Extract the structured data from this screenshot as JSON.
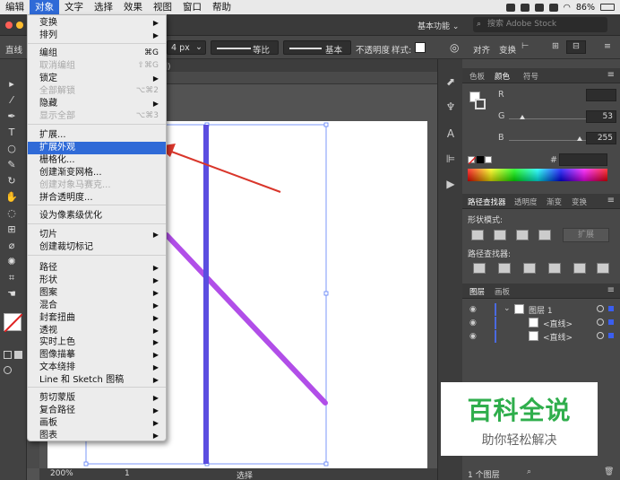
{
  "menubar": {
    "items": [
      "编辑",
      "对象",
      "文字",
      "选择",
      "效果",
      "视图",
      "窗口",
      "帮助"
    ],
    "active_index": 1,
    "battery": "86%"
  },
  "titlebar": {
    "workspace": "基本功能",
    "stock_search_placeholder": "搜索 Adobe Stock"
  },
  "controlbar": {
    "tool_label": "直线",
    "stroke_size": "4 px",
    "profile_label": "等比",
    "brush_label": "基本",
    "opacity_label": "不透明度",
    "style_label": "样式:",
    "align_label": "对齐",
    "transform_label": "变换"
  },
  "document": {
    "tab_suffix": "图)",
    "zoom": "200%",
    "page": "1",
    "status_label": "选择"
  },
  "object_menu": {
    "items": [
      {
        "label": "变换",
        "submenu": true
      },
      {
        "label": "排列",
        "submenu": true
      },
      {
        "label": "编组",
        "shortcut": "⌘G"
      },
      {
        "label": "取消编组",
        "shortcut": "⇧⌘G",
        "disabled": true
      },
      {
        "label": "锁定",
        "submenu": true
      },
      {
        "label": "全部解锁",
        "shortcut": "⌥⌘2",
        "disabled": true
      },
      {
        "label": "隐藏",
        "submenu": true
      },
      {
        "label": "显示全部",
        "shortcut": "⌥⌘3",
        "disabled": true
      },
      {
        "label": "扩展..."
      },
      {
        "label": "扩展外观",
        "highlighted": true
      },
      {
        "label": "栅格化..."
      },
      {
        "label": "创建渐变网格..."
      },
      {
        "label": "创建对象马赛克...",
        "disabled": true
      },
      {
        "label": "拼合透明度..."
      },
      {
        "label": "设为像素级优化"
      },
      {
        "label": "切片",
        "submenu": true
      },
      {
        "label": "创建裁切标记"
      },
      {
        "label": "路径",
        "submenu": true
      },
      {
        "label": "形状",
        "submenu": true
      },
      {
        "label": "图案",
        "submenu": true
      },
      {
        "label": "混合",
        "submenu": true
      },
      {
        "label": "封套扭曲",
        "submenu": true
      },
      {
        "label": "透视",
        "submenu": true
      },
      {
        "label": "实时上色",
        "submenu": true
      },
      {
        "label": "图像描摹",
        "submenu": true
      },
      {
        "label": "文本绕排",
        "submenu": true
      },
      {
        "label": "Line 和 Sketch 图稿",
        "submenu": true
      },
      {
        "label": "剪切蒙版",
        "submenu": true
      },
      {
        "label": "复合路径",
        "submenu": true
      },
      {
        "label": "画板",
        "submenu": true
      },
      {
        "label": "图表",
        "submenu": true
      }
    ]
  },
  "color_panel": {
    "tabs": [
      "色板",
      "颜色",
      "符号"
    ],
    "active_tab": "颜色",
    "channels": [
      {
        "name": "R",
        "value": ""
      },
      {
        "name": "G",
        "value": "53"
      },
      {
        "name": "B",
        "value": "255"
      }
    ],
    "hex_label": "#"
  },
  "pathfinder_panel": {
    "tabs": [
      "路径查找器",
      "透明度",
      "渐变",
      "变换"
    ],
    "shape_modes_label": "形状模式:",
    "expand_label": "扩展",
    "pathfinders_label": "路径查找器:"
  },
  "layers_panel": {
    "tabs": [
      "图层",
      "画板"
    ],
    "layer_name": "图层 1",
    "sublayers": [
      "<直线>",
      "<直线>"
    ],
    "footer": "1 个图层"
  },
  "colors": {
    "vertical_line": "#5b4de0",
    "diagonal_line": "#b14ee8",
    "menu_highlight": "#2f6ad7",
    "annotation_arrow": "#d9362b",
    "watermark_green": "#2fae4c"
  },
  "watermark": {
    "title": "百科全说",
    "subtitle": "助你轻松解决"
  }
}
